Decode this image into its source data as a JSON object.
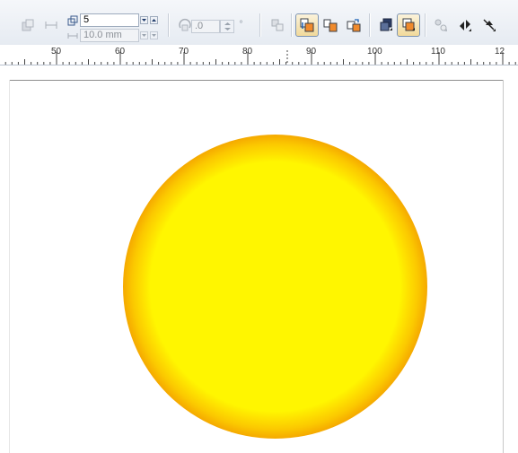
{
  "toolbar": {
    "steps_value": "5",
    "offset_value": "10.0 mm",
    "angle_value": ".0",
    "angle_unit": "°",
    "icons": [
      "blend-direct-icon",
      "blend-spacing-icon",
      "steps-icon",
      "offset-icon",
      "rotate-icon",
      "degree-label",
      "loop-blend-icon",
      "direct-blend-icon",
      "clockwise-blend-icon",
      "counterclockwise-blend-icon",
      "object-color-accel-icon",
      "accelerate-sizes-icon",
      "misc-blend-options-icon",
      "start-end-props-icon",
      "path-props-icon"
    ]
  },
  "ruler": {
    "unit": "mm",
    "labels": [
      "50",
      "60",
      "70",
      "80",
      "90",
      "100",
      "110",
      "12"
    ]
  },
  "canvas": {
    "contour_colors": [
      "#f5a900",
      "#f8b800",
      "#fbc800",
      "#fdd700",
      "#fee600",
      "#fff600"
    ]
  }
}
